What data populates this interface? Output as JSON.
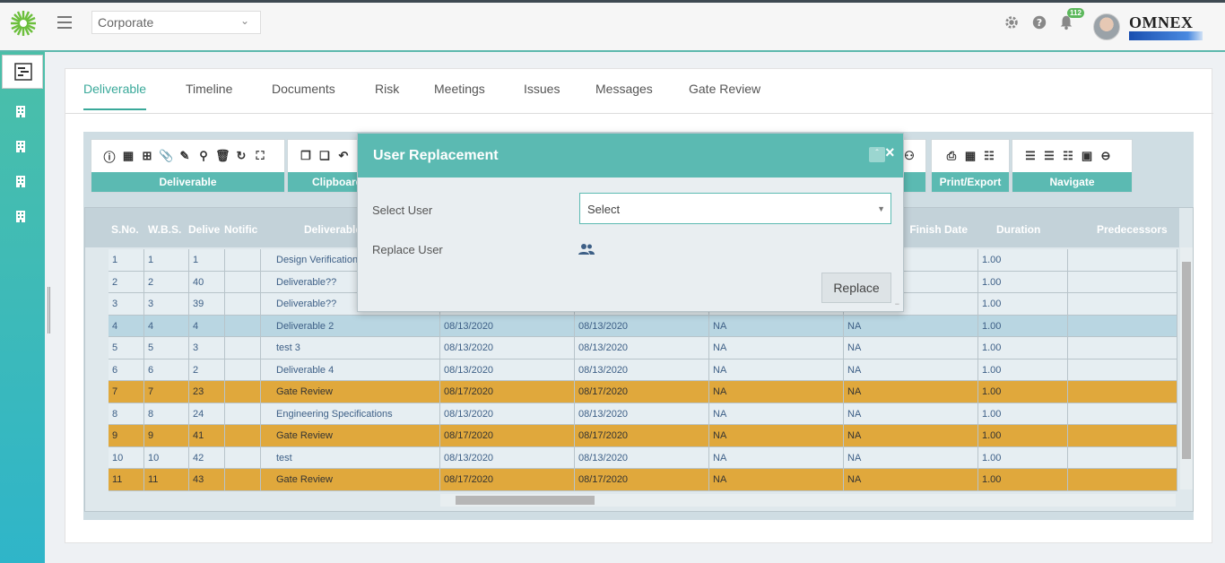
{
  "header": {
    "company_select": "Corporate",
    "notification_count": "112",
    "brand": "OMNEX"
  },
  "tabs": [
    {
      "label": "Deliverable",
      "active": true
    },
    {
      "label": "Timeline"
    },
    {
      "label": "Documents"
    },
    {
      "label": "Risk"
    },
    {
      "label": "Meetings"
    },
    {
      "label": "Issues"
    },
    {
      "label": "Messages"
    },
    {
      "label": "Gate Review"
    }
  ],
  "toolbar": {
    "groups": [
      {
        "label": "Deliverable"
      },
      {
        "label": "Clipboard"
      },
      {
        "label": "Print/Export"
      },
      {
        "label": "Navigate"
      }
    ]
  },
  "grid": {
    "columns": [
      "S.No.",
      "W.B.S.",
      "Delive",
      "Notific",
      "Deliverable",
      "Finish Date",
      "Duration",
      "Predecessors"
    ],
    "rows": [
      {
        "sno": "1",
        "wbs": "1",
        "id": "1",
        "name": "Design Verification",
        "start": "",
        "finish": "",
        "bl": "",
        "fin": "",
        "dur": "1.00",
        "type": "normal"
      },
      {
        "sno": "2",
        "wbs": "2",
        "id": "40",
        "name": "Deliverable??",
        "start": "",
        "finish": "",
        "bl": "",
        "fin": "",
        "dur": "1.00",
        "type": "normal"
      },
      {
        "sno": "3",
        "wbs": "3",
        "id": "39",
        "name": "Deliverable??",
        "start": "",
        "finish": "",
        "bl": "",
        "fin": "",
        "dur": "1.00",
        "type": "normal"
      },
      {
        "sno": "4",
        "wbs": "4",
        "id": "4",
        "name": "Deliverable 2",
        "start": "08/13/2020",
        "finish": "08/13/2020",
        "bl": "NA",
        "fin": "NA",
        "dur": "1.00",
        "type": "sel"
      },
      {
        "sno": "5",
        "wbs": "5",
        "id": "3",
        "name": "test 3",
        "start": "08/13/2020",
        "finish": "08/13/2020",
        "bl": "NA",
        "fin": "NA",
        "dur": "1.00",
        "type": "normal"
      },
      {
        "sno": "6",
        "wbs": "6",
        "id": "2",
        "name": "Deliverable 4",
        "start": "08/13/2020",
        "finish": "08/13/2020",
        "bl": "NA",
        "fin": "NA",
        "dur": "1.00",
        "type": "normal"
      },
      {
        "sno": "7",
        "wbs": "7",
        "id": "23",
        "name": "Gate Review",
        "start": "08/17/2020",
        "finish": "08/17/2020",
        "bl": "NA",
        "fin": "NA",
        "dur": "1.00",
        "type": "gate"
      },
      {
        "sno": "8",
        "wbs": "8",
        "id": "24",
        "name": "Engineering Specifications",
        "start": "08/13/2020",
        "finish": "08/13/2020",
        "bl": "NA",
        "fin": "NA",
        "dur": "1.00",
        "type": "normal"
      },
      {
        "sno": "9",
        "wbs": "9",
        "id": "41",
        "name": "Gate Review",
        "start": "08/17/2020",
        "finish": "08/17/2020",
        "bl": "NA",
        "fin": "NA",
        "dur": "1.00",
        "type": "gate"
      },
      {
        "sno": "10",
        "wbs": "10",
        "id": "42",
        "name": "test",
        "start": "08/13/2020",
        "finish": "08/13/2020",
        "bl": "NA",
        "fin": "NA",
        "dur": "1.00",
        "type": "normal"
      },
      {
        "sno": "11",
        "wbs": "11",
        "id": "43",
        "name": "Gate Review",
        "start": "08/17/2020",
        "finish": "08/17/2020",
        "bl": "NA",
        "fin": "NA",
        "dur": "1.00",
        "type": "gate"
      }
    ]
  },
  "modal": {
    "title": "User Replacement",
    "select_user_label": "Select User",
    "select_value": "Select",
    "replace_user_label": "Replace User",
    "replace_button": "Replace"
  },
  "colors": {
    "accent": "#5bbab2",
    "gate_row": "#e0a83c",
    "selected_row": "#b9d6e2"
  }
}
